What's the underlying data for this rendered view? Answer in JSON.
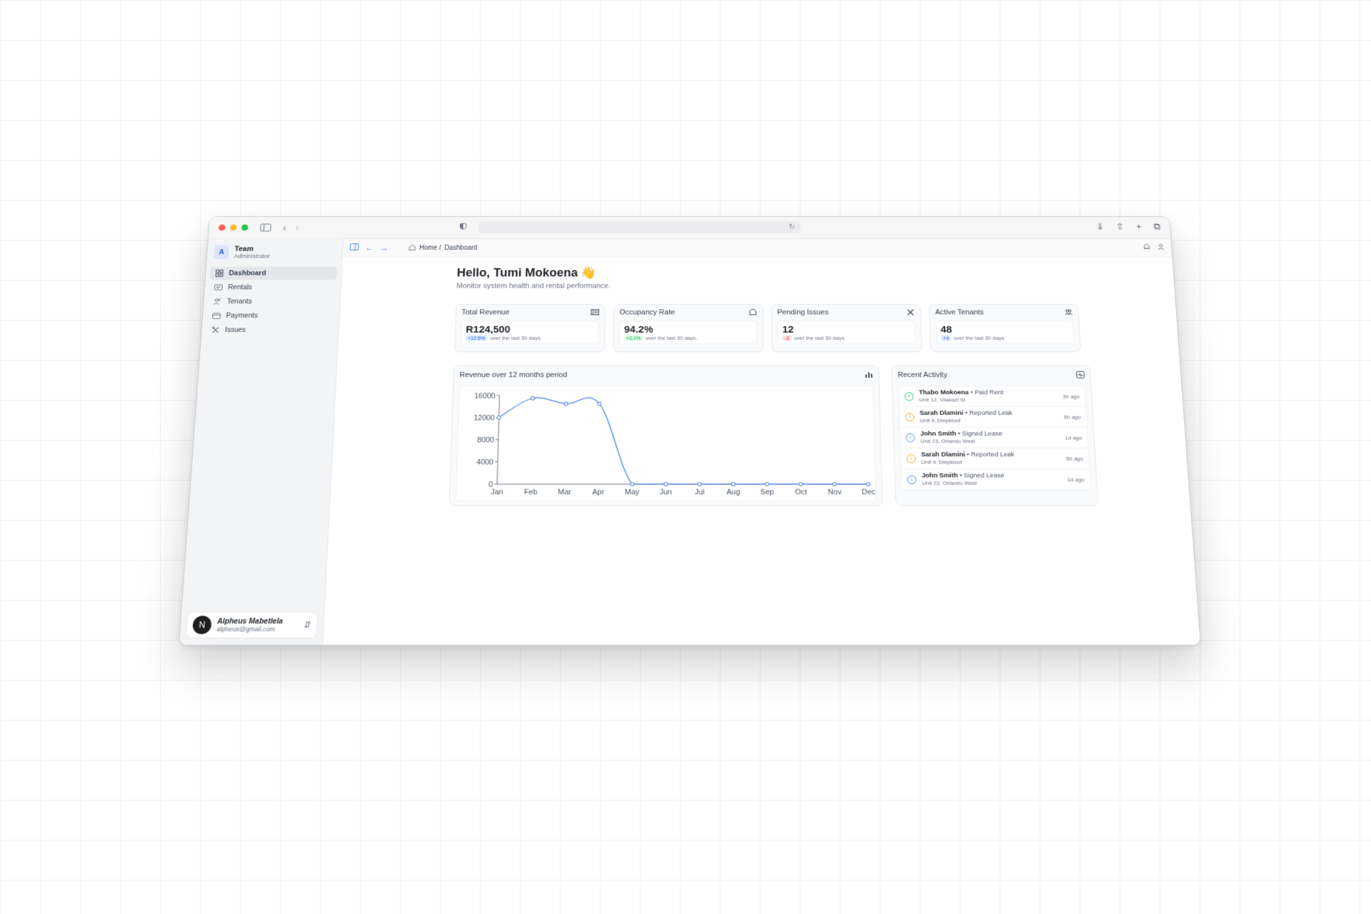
{
  "sidebar": {
    "team_initial": "A",
    "team_name": "Team",
    "team_role": "Administrator",
    "nav": [
      {
        "label": "Dashboard",
        "icon": "grid-icon",
        "active": true
      },
      {
        "label": "Rentals",
        "icon": "id-card-icon",
        "active": false
      },
      {
        "label": "Tenants",
        "icon": "users-icon",
        "active": false
      },
      {
        "label": "Payments",
        "icon": "wallet-icon",
        "active": false
      },
      {
        "label": "Issues",
        "icon": "wrench-icon",
        "active": false
      }
    ],
    "user": {
      "initial": "N",
      "name": "Alpheus Mabetlela",
      "email": "alpheus@gmail.com"
    }
  },
  "topbar": {
    "breadcrumb_home": "Home /",
    "breadcrumb_current": "Dashboard"
  },
  "greeting": {
    "title": "Hello, Tumi Mokoena 👋",
    "subtitle": "Monitor system health and rental performance."
  },
  "stats": [
    {
      "label": "Total Revenue",
      "value": "R124,500",
      "delta": "+12.5%",
      "delta_color": "#2563eb",
      "delta_bg": "#dbeafe",
      "period": "over the last 30 days."
    },
    {
      "label": "Occupancy Rate",
      "value": "94.2%",
      "delta": "+2.1%",
      "delta_color": "#16a34a",
      "delta_bg": "#dcfce7",
      "period": "over the last 30 days."
    },
    {
      "label": "Pending Issues",
      "value": "12",
      "delta": "-3",
      "delta_color": "#dc2626",
      "delta_bg": "#fee2e2",
      "period": "over the last 30 days."
    },
    {
      "label": "Active Tenants",
      "value": "48",
      "delta": "+4",
      "delta_color": "#2563eb",
      "delta_bg": "#dbeafe",
      "period": "over the last 30 days."
    }
  ],
  "chart_panel": {
    "title": "Revenue over 12 months period"
  },
  "chart_data": {
    "type": "line",
    "categories": [
      "Jan",
      "Feb",
      "Mar",
      "Apr",
      "May",
      "Jun",
      "Jul",
      "Aug",
      "Sep",
      "Oct",
      "Nov",
      "Dec"
    ],
    "series": [
      {
        "values": [
          12000,
          15500,
          14500,
          14500,
          0,
          0,
          0,
          0,
          0,
          0,
          0,
          0
        ]
      }
    ],
    "yticks": [
      0,
      4000,
      8000,
      12000,
      16000
    ],
    "ylim": [
      0,
      16000
    ],
    "color": "#5b8def",
    "grid": false
  },
  "activity": {
    "title": "Recent Activity",
    "items": [
      {
        "name": "Thabo Mokoena",
        "action": "• Paid Rent",
        "unit": "Unit 12, Vilakazi St",
        "time": "3h ago",
        "status": "success",
        "color": "#22c55e"
      },
      {
        "name": "Sarah Dlamini",
        "action": "• Reported Leak",
        "unit": "Unit 4, Diepkloof",
        "time": "5h ago",
        "status": "warning",
        "color": "#f59e0b"
      },
      {
        "name": "John Smith",
        "action": "• Signed Lease",
        "unit": "Unit 23, Orlando West",
        "time": "1d ago",
        "status": "info",
        "color": "#3b82f6"
      },
      {
        "name": "Sarah Dlamini",
        "action": "• Reported Leak",
        "unit": "Unit 4, Diepkloof",
        "time": "5h ago",
        "status": "warning",
        "color": "#f59e0b"
      },
      {
        "name": "John Smith",
        "action": "• Signed Lease",
        "unit": "Unit 22, Orlando West",
        "time": "1d ago",
        "status": "info",
        "color": "#3b82f6"
      }
    ]
  }
}
